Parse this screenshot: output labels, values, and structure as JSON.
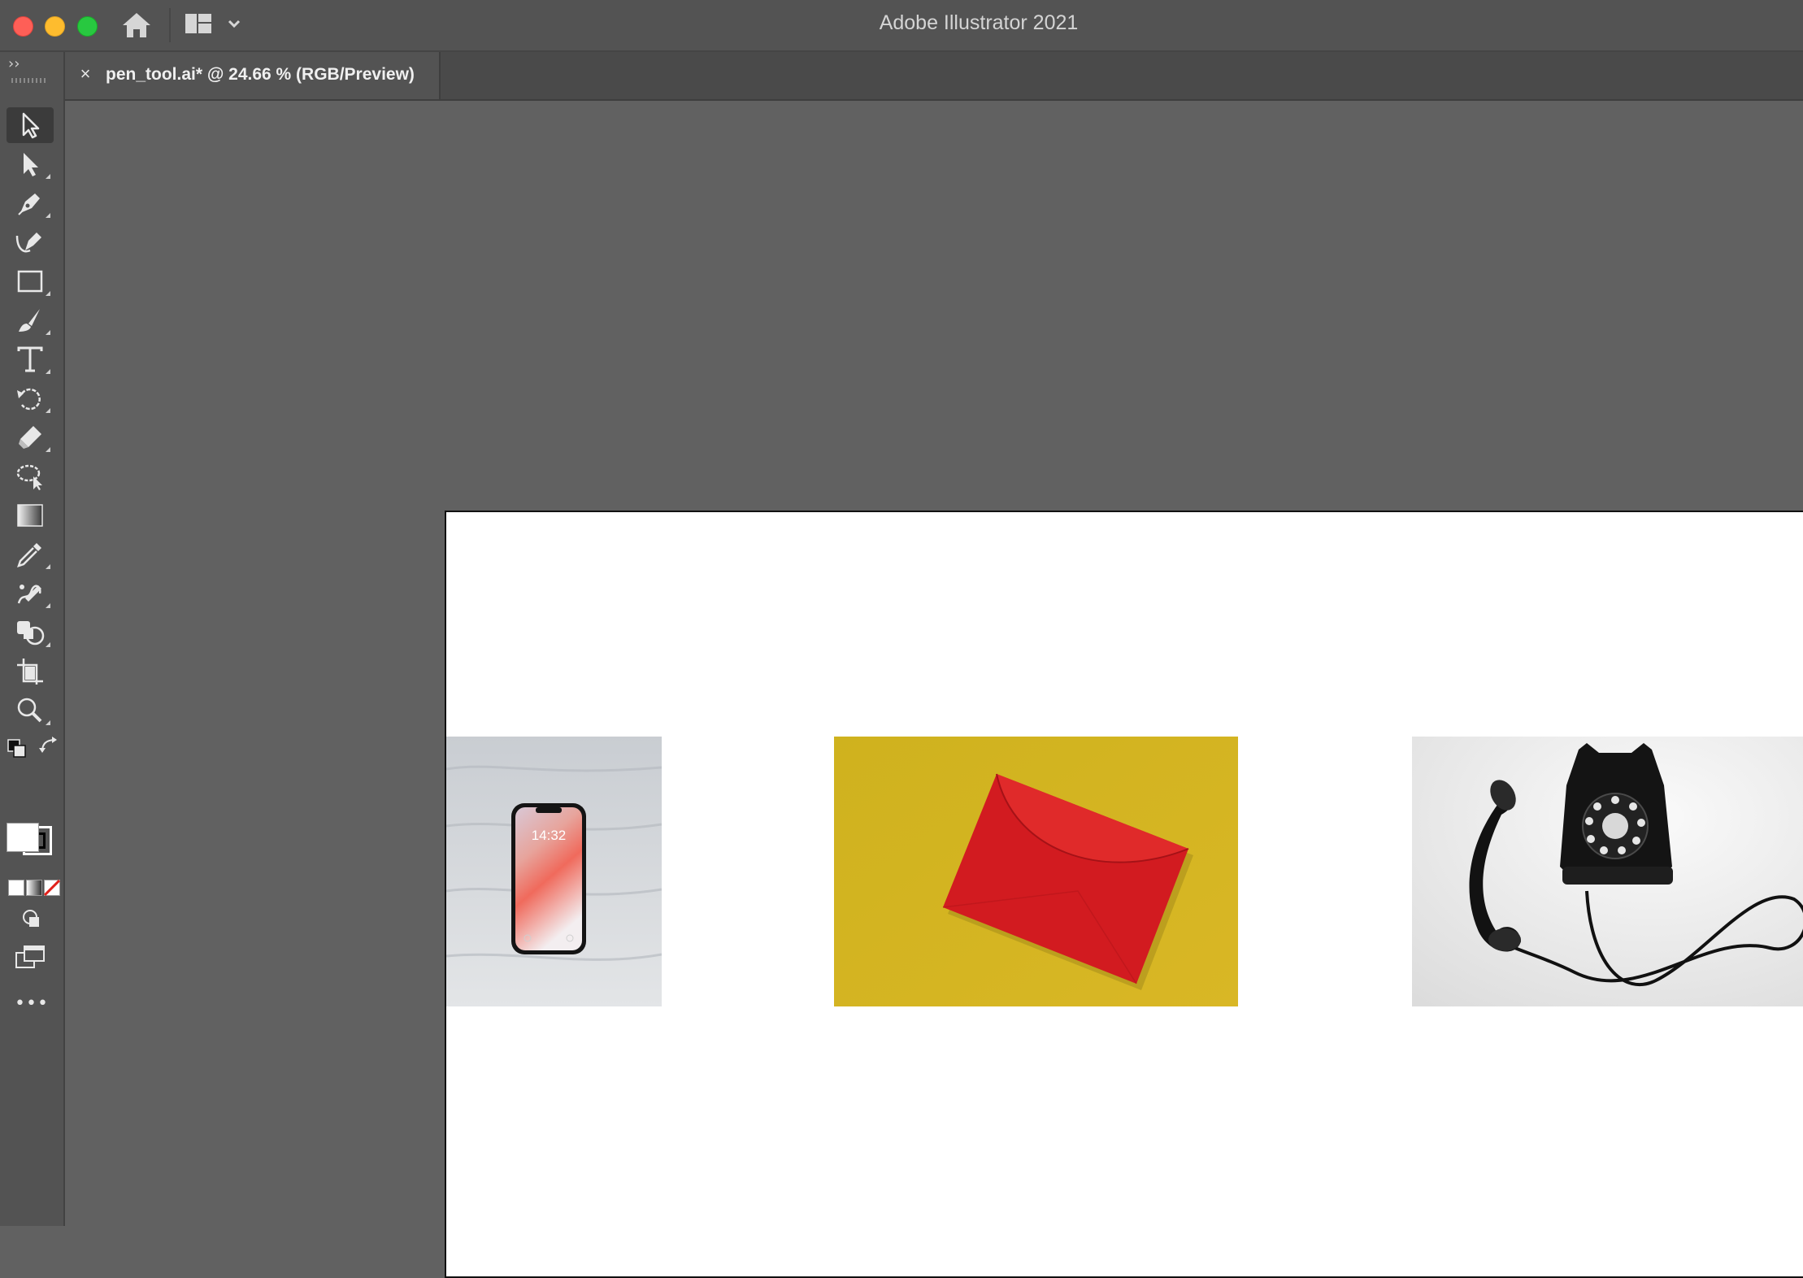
{
  "window": {
    "app_title": "Adobe Illustrator 2021",
    "traffic_lights": {
      "close": "#fe5f57",
      "minimize": "#febc2e",
      "maximize": "#28c840"
    },
    "icons": {
      "home": "home-icon",
      "workspace": "workspace-switcher-icon"
    }
  },
  "document_tab": {
    "title": "pen_tool.ai* @ 24.66 % (RGB/Preview)",
    "close_glyph": "×"
  },
  "toolbar": {
    "collapse_glyph": "››",
    "tools": [
      {
        "name": "selection-tool",
        "active": true
      },
      {
        "name": "direct-selection-tool"
      },
      {
        "name": "pen-tool"
      },
      {
        "name": "curvature-tool"
      },
      {
        "name": "rectangle-tool"
      },
      {
        "name": "paintbrush-tool"
      },
      {
        "name": "type-tool"
      },
      {
        "name": "rotate-tool"
      },
      {
        "name": "eraser-tool"
      },
      {
        "name": "lasso-tool"
      },
      {
        "name": "gradient-tool"
      },
      {
        "name": "eyedropper-tool"
      },
      {
        "name": "puppet-warp-tool"
      },
      {
        "name": "shape-builder-tool"
      },
      {
        "name": "artboard-tool"
      },
      {
        "name": "zoom-tool"
      }
    ],
    "fill_color": "#ffffff",
    "stroke_color": "#000000",
    "more_glyph": "•••"
  },
  "artboard": {
    "images": [
      {
        "name": "smartphone-photo",
        "lock_time": "14:32"
      },
      {
        "name": "red-envelope-photo"
      },
      {
        "name": "rotary-telephone-photo"
      }
    ]
  }
}
